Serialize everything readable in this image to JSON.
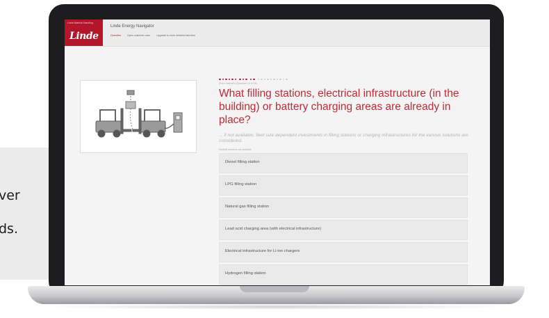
{
  "caption": {
    "line1": "ver",
    "line2": "ds."
  },
  "app": {
    "logo_tagline": "Linde Material Handling",
    "logo_text": "Linde",
    "title": "Linde Energy Navigator",
    "nav": [
      "Overview",
      "Open customer case",
      "Upgrade to more detailed interview"
    ],
    "brand_color": "#b3152b"
  },
  "question": {
    "progress_completed": 11,
    "progress_total": 21,
    "subtitle": "(Fleet interview (Question 10 of 18)",
    "title": "What filling stations, electrical infrastructure (in the building) or battery charging areas are already in place?",
    "hint": "... if not available, fleet size dependent investments in filling stations or charging infrastructures for the various solutions are considered.",
    "multiple_note": "Multiple answers are possible",
    "options": [
      "Diesel filling station",
      "LPG filling station",
      "Natural gas filling station",
      "Lead acid charging area (with electrical infrastructure)",
      "Electrical infrastructure for Li-ion chargers",
      "Hydrogen filling station"
    ]
  },
  "illustration": {
    "icon": "forklift-charging-icon"
  }
}
